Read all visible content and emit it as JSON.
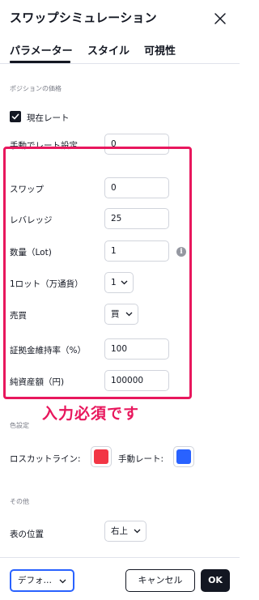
{
  "dialog": {
    "title": "スワップシミュレーション"
  },
  "tabs": [
    {
      "label": "パラメーター",
      "active": true
    },
    {
      "label": "スタイル",
      "active": false
    },
    {
      "label": "可視性",
      "active": false
    }
  ],
  "position_price": {
    "section_title": "ポジションの価格",
    "current_rate": {
      "label": "現在レート",
      "checked": true
    },
    "manual_rate": {
      "label": "手動でレート設定",
      "value": "0"
    }
  },
  "params": {
    "swap": {
      "label": "スワップ",
      "value": "0"
    },
    "leverage": {
      "label": "レバレッジ",
      "value": "25"
    },
    "quantity": {
      "label": "数量（Lot)",
      "value": "1"
    },
    "lot_unit": {
      "label": "1ロット（万通貨）",
      "value": "1"
    },
    "side": {
      "label": "売買",
      "value": "買"
    },
    "margin_rate": {
      "label": "証拠金維持率（%）",
      "value": "100"
    },
    "net_assets": {
      "label": "純資産額（円)",
      "value": "100000"
    }
  },
  "annotation": "入力必須です",
  "colors": {
    "section_title": "色設定",
    "losscut": {
      "label": "ロスカットライン:",
      "color": "#f23645"
    },
    "manual_rate": {
      "label": "手動レート:",
      "color": "#2962ff"
    }
  },
  "other": {
    "section_title": "その他",
    "table_position": {
      "label": "表の位置",
      "value": "右上"
    }
  },
  "footer": {
    "default_label": "デフォ…",
    "cancel_label": "キャンセル",
    "ok_label": "OK"
  },
  "theme": {
    "highlight_color": "#e8175d",
    "accent": "#2962ff"
  }
}
